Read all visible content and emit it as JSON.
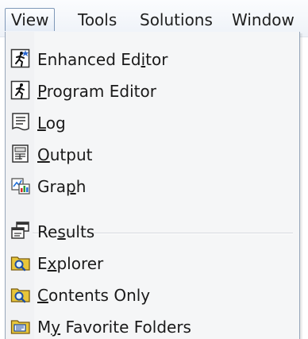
{
  "menubar": {
    "items": [
      {
        "label": "View",
        "active": true
      },
      {
        "label": "Tools"
      },
      {
        "label": "Solutions"
      },
      {
        "label": "Window"
      }
    ]
  },
  "view_menu": {
    "items": [
      {
        "pre": "Enhanced Ed",
        "key": "i",
        "post": "tor",
        "icon": "enhanced-editor-icon"
      },
      {
        "pre": "",
        "key": "P",
        "post": "rogram Editor",
        "icon": "program-editor-icon"
      },
      {
        "pre": "",
        "key": "L",
        "post": "og",
        "icon": "log-icon"
      },
      {
        "pre": "",
        "key": "O",
        "post": "utput",
        "icon": "output-icon"
      },
      {
        "pre": "Gra",
        "key": "p",
        "post": "h",
        "icon": "graph-icon"
      },
      {
        "pre": "Re",
        "key": "s",
        "post": "ults",
        "icon": "results-icon"
      },
      {
        "pre": "E",
        "key": "x",
        "post": "plorer",
        "icon": "explorer-icon"
      },
      {
        "pre": "",
        "key": "C",
        "post": "ontents Only",
        "icon": "contents-only-icon"
      },
      {
        "pre": "M",
        "key": "y",
        "post": " Favorite Folders",
        "icon": "favorite-folders-icon"
      }
    ]
  },
  "colors": {
    "menu_background": "#f5f6f7",
    "menu_border": "#97a6ba",
    "active_border": "#7f98b8",
    "text": "#1a1a1a"
  }
}
